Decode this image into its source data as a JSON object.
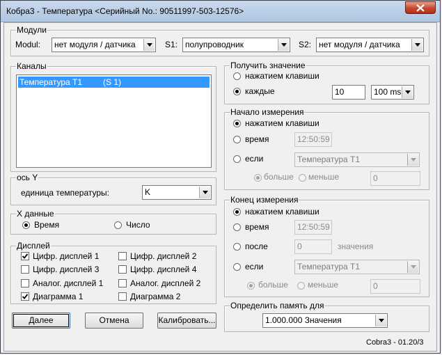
{
  "window": {
    "title": "Кобра3 - Температура  <Серийный No.: 90511997-503-12576>"
  },
  "modules": {
    "legend": "Модули",
    "modul_label": "Modul:",
    "modul_value": "нет модуля / датчика",
    "s1_label": "S1:",
    "s1_value": "полупроводник",
    "s2_label": "S2:",
    "s2_value": "нет модуля / датчика"
  },
  "channels": {
    "legend": "Каналы",
    "items": [
      {
        "name": "Температура T1",
        "sensor": "(S 1)"
      }
    ]
  },
  "y_axis": {
    "legend": "ось Y",
    "unit_label": "единица температуры:",
    "unit_value": "K"
  },
  "x_data": {
    "legend": "X данные",
    "time_label": "Время",
    "number_label": "Число"
  },
  "displays": {
    "legend": "Дисплей",
    "items": [
      {
        "label": "Цифр. дисплей 1",
        "checked": true
      },
      {
        "label": "Цифр. дисплей 2",
        "checked": false
      },
      {
        "label": "Цифр. дисплей 3",
        "checked": false
      },
      {
        "label": "Цифр. дисплей 4",
        "checked": false
      },
      {
        "label": "Аналог. дисплей 1",
        "checked": false
      },
      {
        "label": "Аналог. дисплей 2",
        "checked": false
      },
      {
        "label": "Диаграмма 1",
        "checked": true
      },
      {
        "label": "Диаграмма 2",
        "checked": false
      }
    ]
  },
  "buttons": {
    "next": "Далее",
    "cancel": "Отмена",
    "calibrate": "Калибровать..."
  },
  "get_value": {
    "legend": "Получить значение",
    "on_key": "нажатием клавиши",
    "every": "каждые",
    "interval_value": "10",
    "interval_unit": "100 ms"
  },
  "start": {
    "legend": "Начало измерения",
    "on_key": "нажатием клавиши",
    "time": "время",
    "time_value": "12:50:59",
    "if": "если",
    "channel_value": "Температура T1",
    "greater": "больше",
    "less": "меньше",
    "threshold": "0"
  },
  "end": {
    "legend": "Конец измерения",
    "on_key": "нажатием клавиши",
    "time": "время",
    "time_value": "12:50:59",
    "after": "после",
    "after_value": "0",
    "after_unit": "значения",
    "if": "если",
    "channel_value": "Температура T1",
    "greater": "больше",
    "less": "меньше",
    "threshold": "0"
  },
  "memory": {
    "legend": "Определить память для",
    "value": "1.000.000 Значения"
  },
  "version": "Cobra3 - 01.20/3"
}
